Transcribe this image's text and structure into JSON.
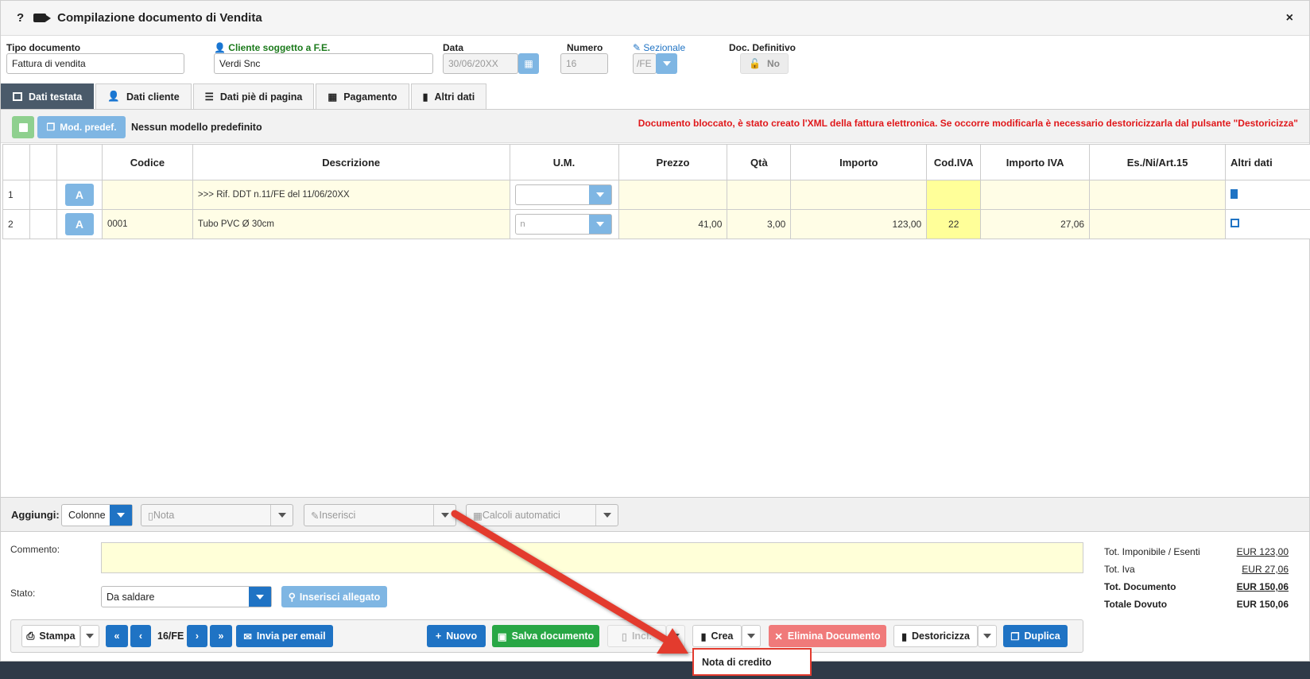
{
  "window": {
    "title": "Compilazione documento di Vendita",
    "help": "?",
    "close": "×"
  },
  "header": {
    "tipo_label": "Tipo documento",
    "tipo_value": "Fattura di vendita",
    "cliente_label": "Cliente soggetto a F.E.",
    "cliente_value": "Verdi Snc",
    "data_label": "Data",
    "data_value": "30/06/20XX",
    "numero_label": "Numero",
    "numero_value": "16",
    "sezionale_label": "Sezionale",
    "sezionale_value": "/FE",
    "definitivo_label": "Doc. Definitivo",
    "definitivo_value": "No"
  },
  "tabs": [
    {
      "label": "Dati testata"
    },
    {
      "label": "Dati cliente"
    },
    {
      "label": "Dati piè di pagina"
    },
    {
      "label": "Pagamento"
    },
    {
      "label": "Altri dati"
    }
  ],
  "toolbar": {
    "mod_label": "Mod. predef.",
    "no_model": "Nessun modello predefinito",
    "warning": "Documento bloccato, è stato creato l'XML della fattura elettronica. Se occorre modificarla è necessario destoricizzarla dal pulsante \"Destoricizza\""
  },
  "grid": {
    "columns": [
      "Codice",
      "Descrizione",
      "U.M.",
      "Prezzo",
      "Qtà",
      "Importo",
      "Cod.IVA",
      "Importo IVA",
      "Es./Ni/Art.15",
      "Altri dati"
    ],
    "rows": [
      {
        "n": "1",
        "a": "A",
        "codice": "",
        "descrizione": ">>> Rif. DDT n.11/FE del 11/06/20XX",
        "um": "",
        "prezzo": "",
        "qta": "",
        "importo": "",
        "iva": "",
        "importo_iva": "",
        "es": ""
      },
      {
        "n": "2",
        "a": "A",
        "codice": "0001",
        "descrizione": "Tubo PVC Ø 30cm",
        "um": "n",
        "prezzo": "41,00",
        "qta": "3,00",
        "importo": "123,00",
        "iva": "22",
        "importo_iva": "27,06",
        "es": ""
      }
    ]
  },
  "aggiungi": {
    "label": "Aggiungi:",
    "colonne": "Colonne",
    "nota": "Nota",
    "inserisci": "Inserisci",
    "calcoli": "Calcoli automatici"
  },
  "footer": {
    "commento_label": "Commento:",
    "stato_label": "Stato:",
    "stato_value": "Da saldare",
    "allegato": "Inserisci allegato"
  },
  "totals": [
    {
      "label": "Tot. Imponibile / Esenti",
      "value": "EUR 123,00"
    },
    {
      "label": "Tot. Iva",
      "value": "EUR 27,06"
    },
    {
      "label": "Tot. Documento",
      "value": "EUR 150,06"
    },
    {
      "label": "Totale Dovuto",
      "value": "EUR 150,06"
    }
  ],
  "bottom": {
    "stampa": "Stampa",
    "page": "16/FE",
    "email": "Invia per email",
    "nuovo": "Nuovo",
    "salva": "Salva documento",
    "incl": "Incl.",
    "crea": "Crea",
    "elimina": "Elimina Documento",
    "destoricizza": "Destoricizza",
    "duplica": "Duplica"
  },
  "menu": {
    "nota_credito": "Nota di credito"
  },
  "colors": {
    "accent": "#1f73c4",
    "annotation": "#e33b2f",
    "warning": "#e0181b"
  }
}
